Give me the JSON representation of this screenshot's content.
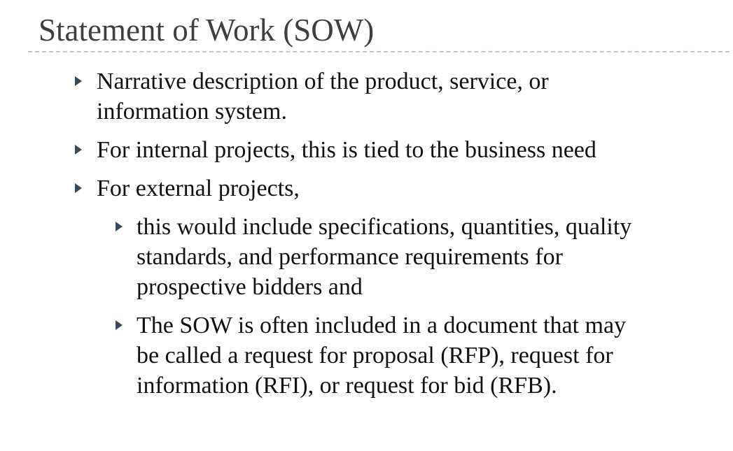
{
  "slide": {
    "title": "Statement of Work (SOW)",
    "bullets": [
      {
        "level": 1,
        "lines": [
          "Narrative description of the product, service, or",
          "information system."
        ]
      },
      {
        "level": 1,
        "lines": [
          "For internal projects, this is tied to the business need"
        ]
      },
      {
        "level": 1,
        "lines": [
          "For external projects,"
        ]
      },
      {
        "level": 2,
        "lines": [
          "this would include specifications, quantities, quality",
          "standards, and performance requirements for",
          "prospective bidders and"
        ]
      },
      {
        "level": 2,
        "lines": [
          "The SOW is often included in a document that may",
          "be called a request for proposal (RFP), request for",
          "information (RFI), or request for bid (RFB)."
        ]
      }
    ],
    "bullet_marker_icon": "triangle-right-icon",
    "colors": {
      "title": "#3f3f3f",
      "text": "#111111",
      "bullet_marker": "#3a4a5c",
      "divider": "#b9c9da"
    }
  }
}
